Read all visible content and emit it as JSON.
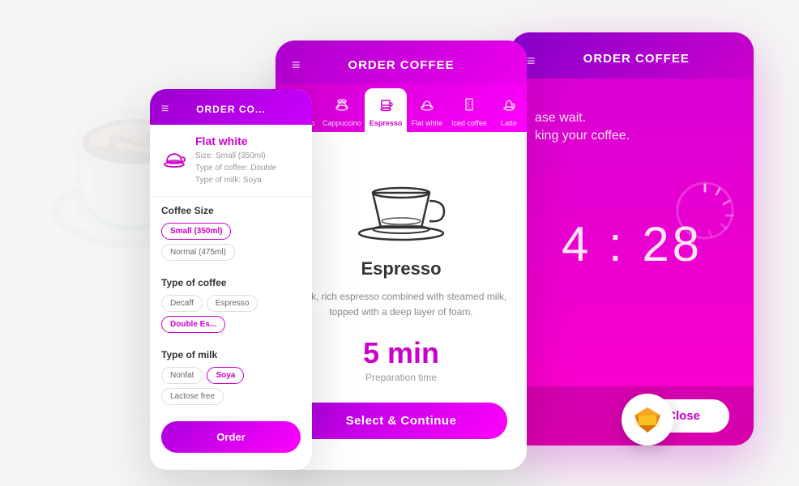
{
  "app": {
    "title": "ORDER COFFEE"
  },
  "background": {
    "watermark_left": "☕",
    "watermark_right": "✓"
  },
  "card_back": {
    "header_title": "ORDER COFFEE",
    "hamburger_icon": "≡",
    "wait_line1": "ase wait.",
    "wait_line2": "king your coffee.",
    "timer": "4 : 28",
    "close_label": "Close"
  },
  "card_mid": {
    "header_title": "ORDER COFFEE",
    "hamburger_icon": "≡",
    "tabs": [
      {
        "label": "Americano",
        "active": false
      },
      {
        "label": "Cappuccino",
        "active": false
      },
      {
        "label": "Espresso",
        "active": true
      },
      {
        "label": "Flat white",
        "active": false
      },
      {
        "label": "Iced coffee",
        "active": false
      },
      {
        "label": "Latte",
        "active": false
      }
    ],
    "coffee_name": "Espresso",
    "description": "Dark, rich espresso combined with steamed milk, topped with a deep layer of foam.",
    "prep_time": "5 min",
    "prep_label": "Preparation time",
    "select_label": "Select & Continue"
  },
  "card_front": {
    "header_title": "ORDER CO...",
    "hamburger_icon": "≡",
    "item_name": "Flat white",
    "item_size": "Size: Small (350ml)",
    "item_coffee_type": "Type of coffee: Double",
    "item_milk_type": "Type of milk: Soya",
    "section_size": "Coffee Size",
    "size_options": [
      {
        "label": "Small (350ml)",
        "active": true
      },
      {
        "label": "Normal (475ml)",
        "active": false
      }
    ],
    "section_coffee": "Type of coffee",
    "coffee_options": [
      {
        "label": "Decaff",
        "active": false
      },
      {
        "label": "Espresso",
        "active": false
      },
      {
        "label": "Double Es...",
        "active": true
      }
    ],
    "section_milk": "Type of milk",
    "milk_options": [
      {
        "label": "Nonfat",
        "active": false
      },
      {
        "label": "Soya",
        "active": true
      },
      {
        "label": "Lactose free",
        "active": false
      }
    ],
    "order_label": "Orde..."
  }
}
